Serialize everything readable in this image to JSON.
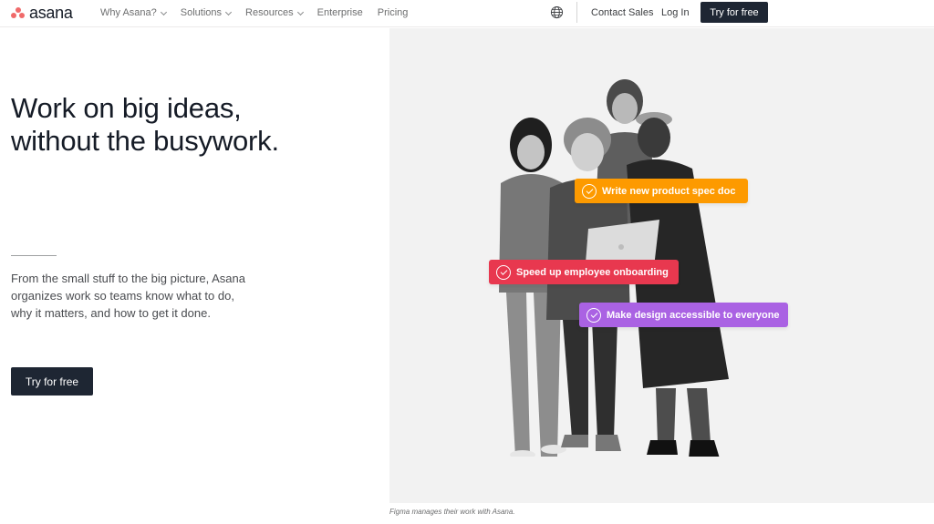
{
  "brand": {
    "name": "asana",
    "logo_color": "#f06a6a"
  },
  "nav": {
    "items": [
      {
        "label": "Why Asana?",
        "has_dropdown": true
      },
      {
        "label": "Solutions",
        "has_dropdown": true
      },
      {
        "label": "Resources",
        "has_dropdown": true
      },
      {
        "label": "Enterprise",
        "has_dropdown": false
      },
      {
        "label": "Pricing",
        "has_dropdown": false
      }
    ],
    "language_icon": "globe-icon",
    "contact_label": "Contact Sales",
    "login_label": "Log In",
    "cta_label": "Try for free"
  },
  "hero": {
    "headline_line1": "Work on big ideas,",
    "headline_line2": "without the busywork.",
    "subtext": "From the small stuff to the big picture, Asana organizes work so teams know what to do, why it matters, and how to get it done.",
    "cta_label": "Try for free",
    "caption": "Figma manages their work with Asana.",
    "tasks": [
      {
        "label": "Write new product spec doc",
        "color": "#fd9a00",
        "icon": "check-circle-icon"
      },
      {
        "label": "Speed up employee onboarding",
        "color": "#e8384f",
        "icon": "check-circle-icon"
      },
      {
        "label": "Make design accessible to everyone",
        "color": "#aa62e3",
        "icon": "check-circle-icon"
      }
    ]
  },
  "colors": {
    "dark_button": "#1e2633",
    "panel_bg": "#f2f2f2",
    "text": "#151b26"
  }
}
